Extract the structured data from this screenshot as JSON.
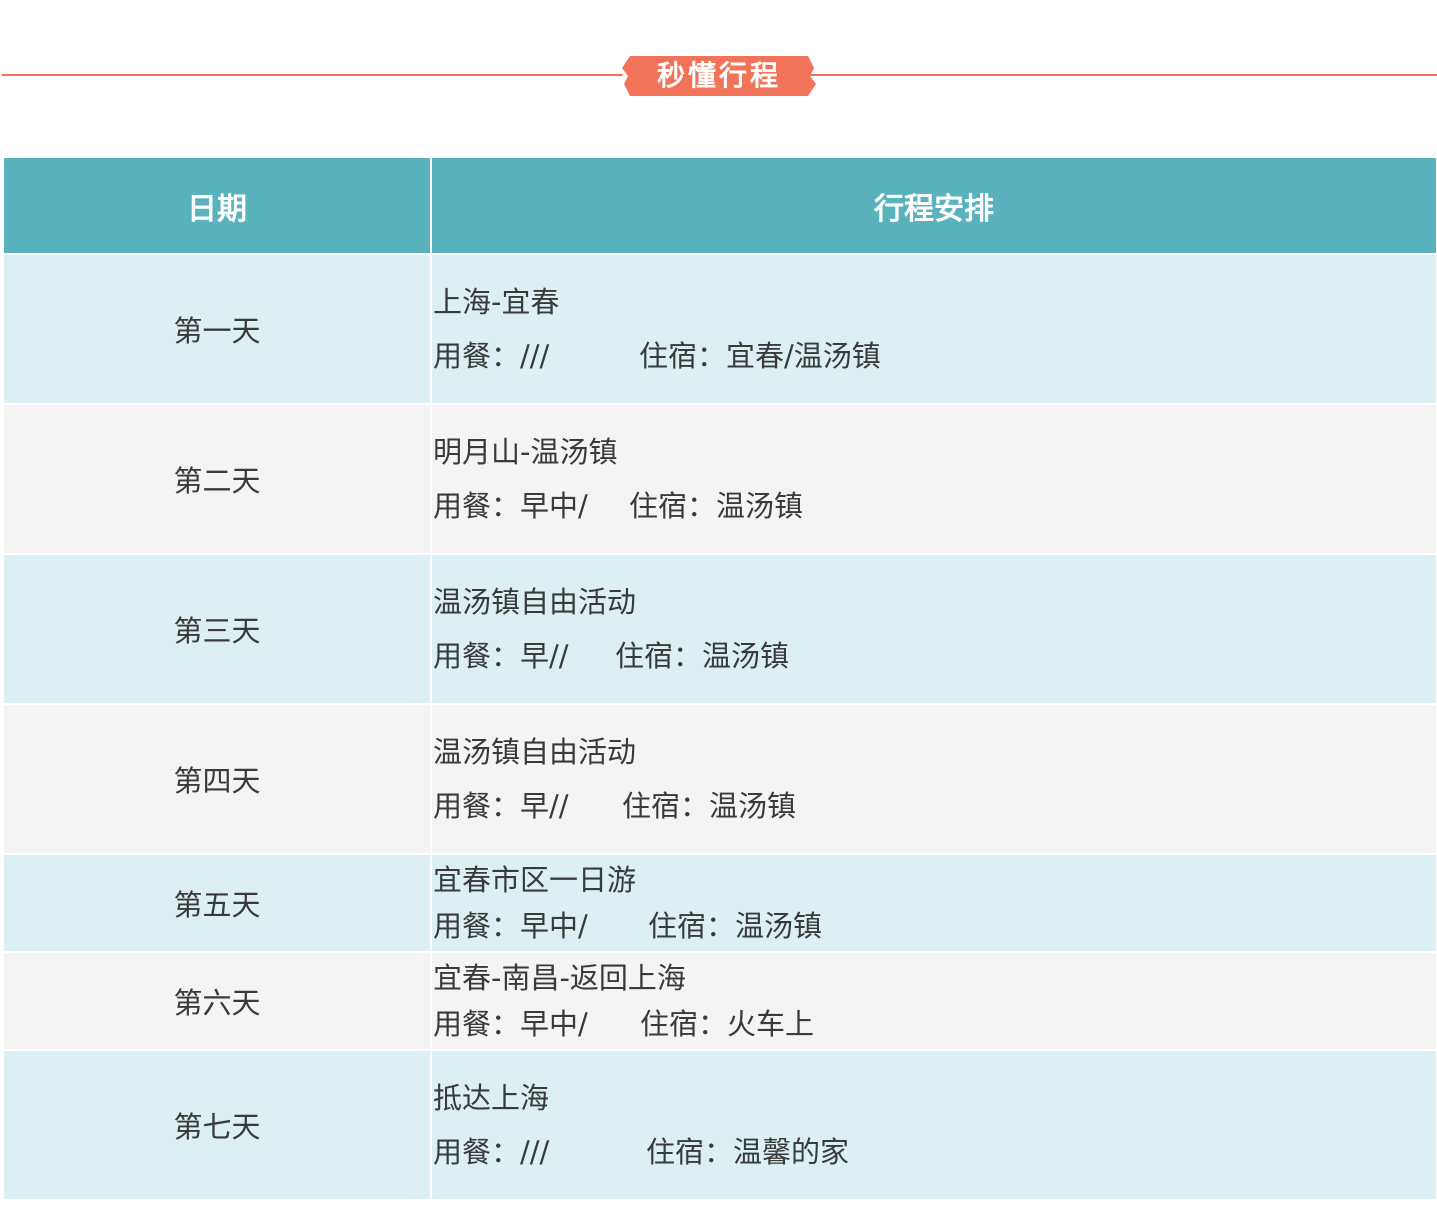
{
  "header": {
    "title": "秒懂行程",
    "accent_color": "#f0735a"
  },
  "table": {
    "columns": [
      "日期",
      "行程安排"
    ],
    "header_color": "#5ab3bc",
    "row_colors": [
      "#dcf0f3",
      "#f4f4f4"
    ],
    "rows": [
      {
        "day": "第一天",
        "route": "上海-宜春",
        "meal": "用餐：///",
        "stay": "住宿：宜春/温汤镇"
      },
      {
        "day": "第二天",
        "route": "明月山-温汤镇",
        "meal": "用餐：早中/",
        "stay": "住宿：温汤镇"
      },
      {
        "day": "第三天",
        "route": "温汤镇自由活动",
        "meal": "用餐：早//",
        "stay": "住宿：温汤镇"
      },
      {
        "day": "第四天",
        "route": "温汤镇自由活动",
        "meal": "用餐：早//",
        "stay": "住宿：温汤镇"
      },
      {
        "day": "第五天",
        "route": "宜春市区一日游",
        "meal": "用餐：早中/",
        "stay": "住宿：温汤镇"
      },
      {
        "day": "第六天",
        "route": "宜春-南昌-返回上海",
        "meal": "用餐：早中/",
        "stay": "住宿：火车上"
      },
      {
        "day": "第七天",
        "route": "抵达上海",
        "meal": "用餐：///",
        "stay": "住宿：温馨的家"
      }
    ]
  }
}
